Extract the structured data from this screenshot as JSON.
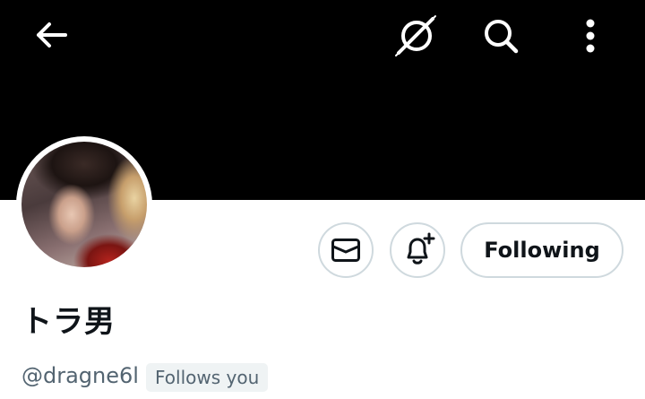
{
  "header": {
    "back_icon": "arrow-left-icon",
    "grok_icon": "grok-icon",
    "search_icon": "search-icon",
    "more_icon": "more-vertical-icon"
  },
  "profile": {
    "display_name": "トラ男",
    "handle": "@dragne6l",
    "follows_you_label": "Follows you"
  },
  "actions": {
    "message_icon": "envelope-icon",
    "notify_icon": "bell-plus-icon",
    "following_label": "Following"
  },
  "colors": {
    "banner": "#000000",
    "text_primary": "#0f1419",
    "text_secondary": "#536471",
    "button_border": "#cfd9de",
    "badge_bg": "#eff3f4"
  }
}
